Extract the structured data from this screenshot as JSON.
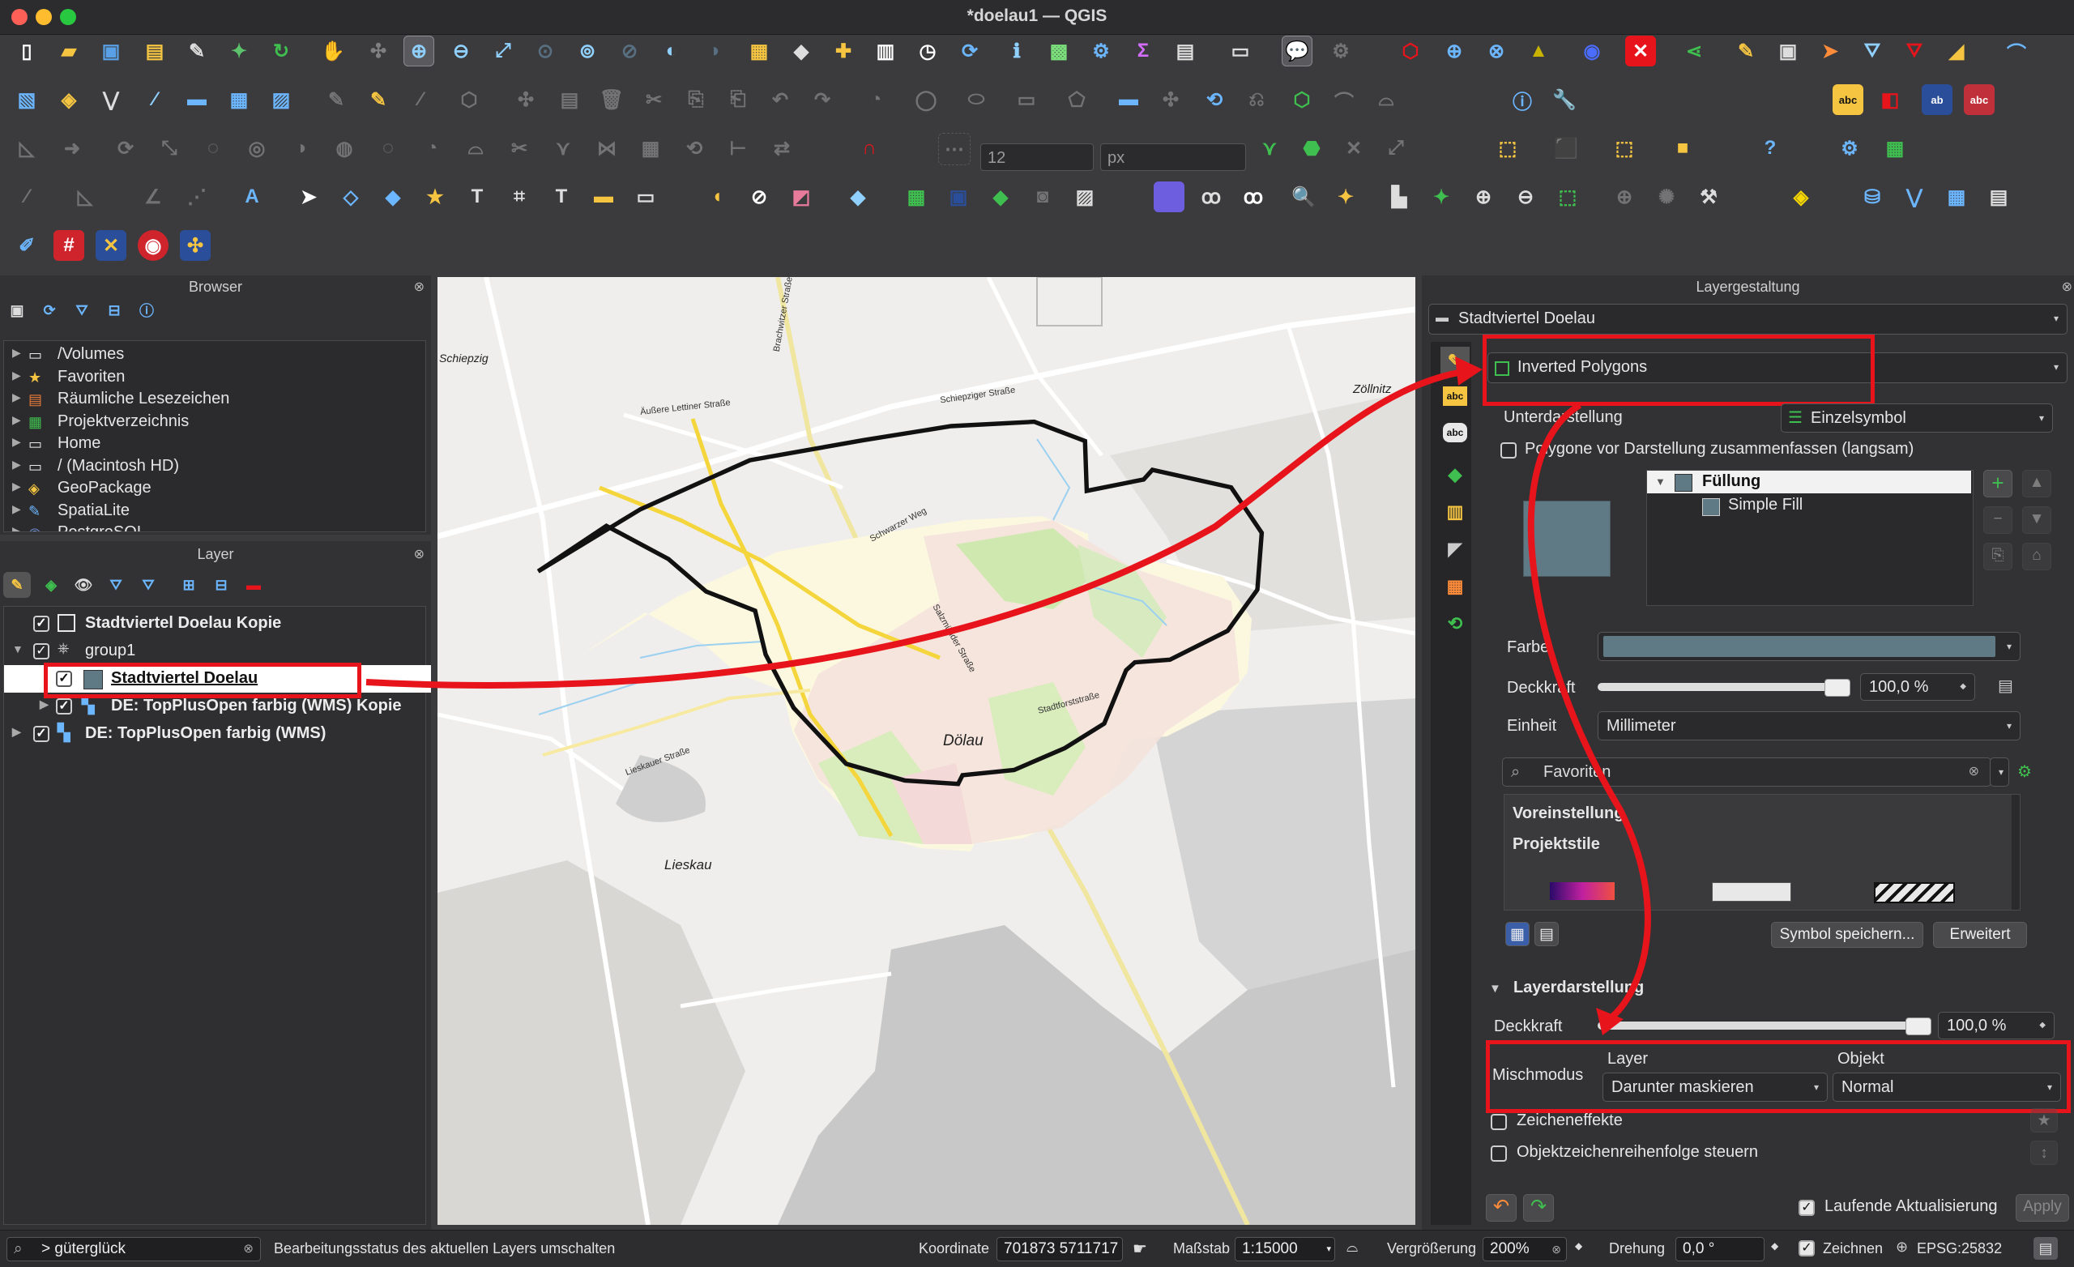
{
  "window": {
    "title": "*doelau1 — QGIS"
  },
  "toolbar": {
    "snapping_tolerance": "12",
    "snapping_unit": "px"
  },
  "browser": {
    "title": "Browser",
    "items": [
      {
        "label": "/Volumes",
        "icon": "folder-icon"
      },
      {
        "label": "Favoriten",
        "icon": "star-icon"
      },
      {
        "label": "Räumliche Lesezeichen",
        "icon": "bookmark-icon"
      },
      {
        "label": "Projektverzeichnis",
        "icon": "project-folder-icon"
      },
      {
        "label": "Home",
        "icon": "folder-icon"
      },
      {
        "label": "/ (Macintosh HD)",
        "icon": "folder-icon"
      },
      {
        "label": "GeoPackage",
        "icon": "geopackage-icon"
      },
      {
        "label": "SpatiaLite",
        "icon": "spatialite-icon"
      },
      {
        "label": "PostgreSQL",
        "icon": "postgresql-icon"
      }
    ]
  },
  "layers": {
    "title": "Layer",
    "items": [
      {
        "label": "Stadtviertel Doelau Kopie",
        "checked": true
      },
      {
        "label": "group1",
        "checked": true
      },
      {
        "label": "Stadtviertel Doelau",
        "checked": true,
        "selected": true
      },
      {
        "label": "DE: TopPlusOpen farbig (WMS) Kopie",
        "checked": true
      },
      {
        "label": "DE: TopPlusOpen farbig (WMS)",
        "checked": true
      }
    ]
  },
  "map": {
    "labels": {
      "doelau": "Dölau",
      "lieskau": "Lieskau",
      "zoellnitz": "Zöllnitz",
      "schiepzig": "Schiepzig",
      "lettiner": "Äußere Lettiner Straße",
      "brachwitzer": "Brachwitzer Straße",
      "schiepziger": "Schiepziger Straße",
      "salzmuender": "Salzmünder Straße",
      "lieskauer": "Lieskauer Straße",
      "stadtforst": "Stadtforststraße",
      "schwarzer": "Schwarzer Weg"
    }
  },
  "styling": {
    "title": "Layergestaltung",
    "layer_name": "Stadtviertel Doelau",
    "renderer": "Inverted Polygons",
    "sub_renderer_label": "Unterdarstellung",
    "sub_renderer": "Einzelsymbol",
    "merge_polygons": "Polygone vor Darstellung zusammenfassen (langsam)",
    "symbol_tree": {
      "fill": "Füllung",
      "simple_fill": "Simple Fill"
    },
    "color_label": "Farbe",
    "opacity_label": "Deckkraft",
    "opacity_value": "100,0 %",
    "unit_label": "Einheit",
    "unit_value": "Millimeter",
    "search_placeholder": "Favoriten",
    "presets": {
      "default": "Voreinstellung",
      "project": "Projektstile"
    },
    "save_symbol": "Symbol speichern...",
    "advanced": "Erweitert",
    "layer_rendering": {
      "title": "Layerdarstellung",
      "opacity_label": "Deckkraft",
      "opacity_value": "100,0 %",
      "blend_label": "Mischmodus",
      "layer_col": "Layer",
      "object_col": "Objekt",
      "layer_blend": "Darunter maskieren",
      "object_blend": "Normal",
      "draw_effects": "Zeicheneffekte",
      "control_order": "Objektzeichenreihenfolge steuern"
    },
    "live_update": "Laufende Aktualisierung",
    "apply": "Apply"
  },
  "status": {
    "locator": "> güterglück",
    "message": "Bearbeitungsstatus des aktuellen Layers umschalten",
    "coord_label": "Koordinate",
    "coord_value": "701873  5711717",
    "scale_label": "Maßstab",
    "scale_value": "1:15000",
    "magnify_label": "Vergrößerung",
    "magnify_value": "200%",
    "rotation_label": "Drehung",
    "rotation_value": "0,0 °",
    "render_label": "Zeichnen",
    "crs": "EPSG:25832"
  },
  "colors": {
    "accent_red": "#e8141b",
    "fill_symbol": "#5f7a85",
    "polygon_fill": "#fbf8df"
  }
}
